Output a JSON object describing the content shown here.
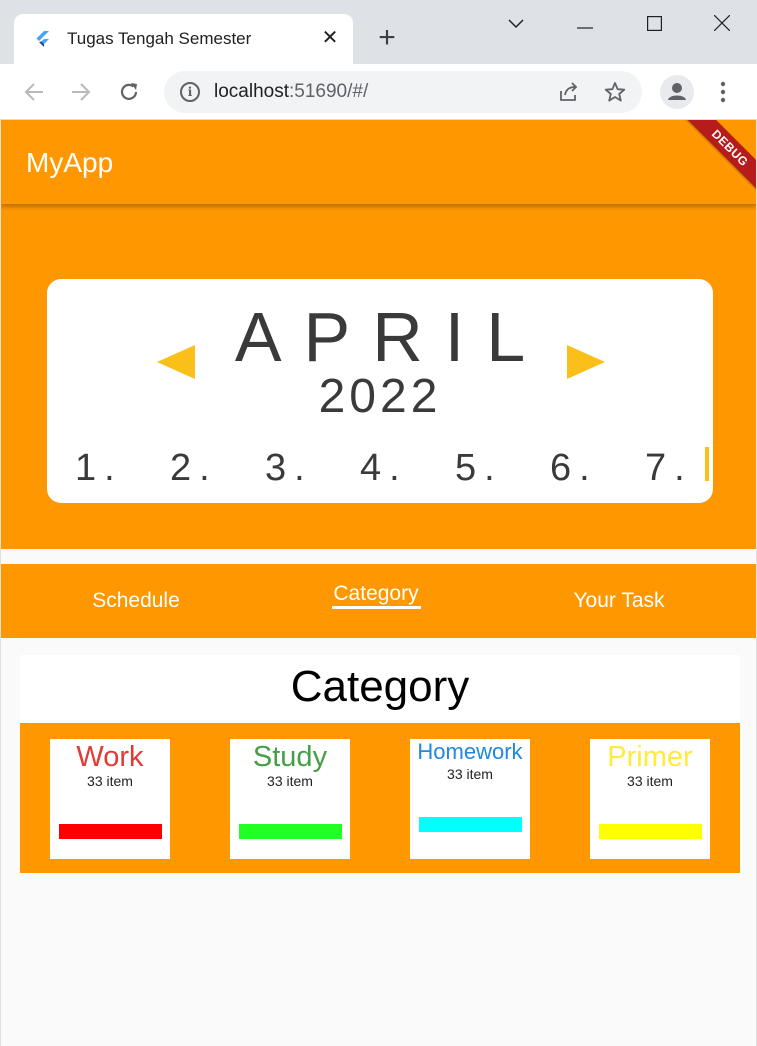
{
  "browser": {
    "tab_title": "Tugas Tengah Semester",
    "tab_close": "✕",
    "new_tab": "+",
    "url_host": "localhost",
    "url_rest": ":51690/#/",
    "icons": {
      "back": "arrow-left-icon",
      "forward": "arrow-right-icon",
      "reload": "reload-icon",
      "info": "info-icon",
      "share": "share-icon",
      "bookmark": "star-icon",
      "profile": "profile-icon",
      "menu": "kebab-menu-icon",
      "tab_search": "chevron-down-icon",
      "minimize": "minimize-icon",
      "maximize": "maximize-icon",
      "close": "close-icon"
    }
  },
  "app": {
    "title": "MyApp",
    "debug_label": "DEBUG",
    "colors": {
      "primary": "#ff9800",
      "accent": "#fbbf1a",
      "debug": "#b71c1c"
    },
    "calendar": {
      "month": "APRIL",
      "year": "2022",
      "days": [
        "1.",
        "2.",
        "3.",
        "4.",
        "5.",
        "6.",
        "7."
      ]
    },
    "tabs": [
      {
        "label": "Schedule",
        "active": false
      },
      {
        "label": "Category",
        "active": true
      },
      {
        "label": "Your Task",
        "active": false
      }
    ],
    "category": {
      "heading": "Category",
      "items": [
        {
          "name": "Work",
          "count": "33 item",
          "color": "#e53935",
          "bar_color": "#ff0000"
        },
        {
          "name": "Study",
          "count": "33 item",
          "color": "#43a047",
          "bar_color": "#22ff22"
        },
        {
          "name": "Homework",
          "count": "33 item",
          "color": "#1e88e5",
          "bar_color": "#00ffff"
        },
        {
          "name": "Primer",
          "count": "33 item",
          "color": "#ffeb3b",
          "bar_color": "#ffff00"
        }
      ]
    }
  }
}
